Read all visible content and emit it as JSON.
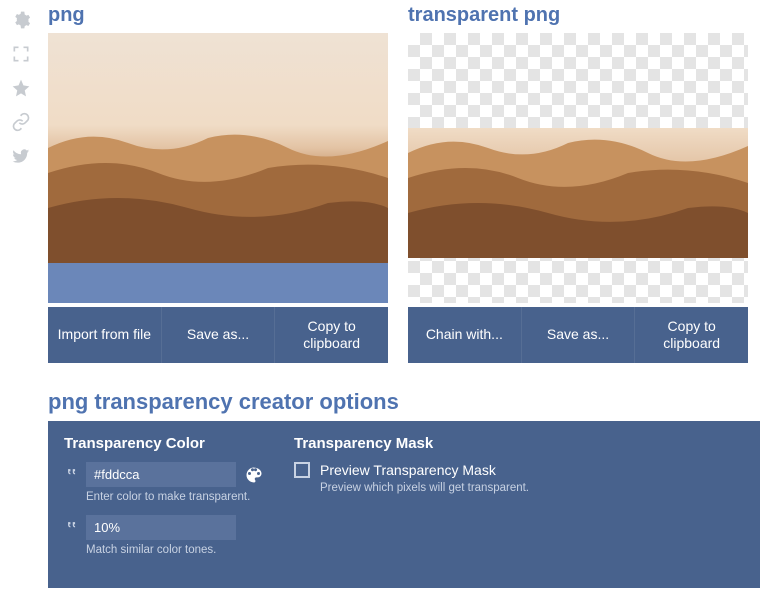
{
  "sidebar": {
    "icons": [
      "gear",
      "fullscreen",
      "star",
      "link",
      "twitter"
    ]
  },
  "panels": {
    "left": {
      "title": "png",
      "buttons": [
        "Import from file",
        "Save as...",
        "Copy to clipboard"
      ]
    },
    "right": {
      "title": "transparent png",
      "buttons": [
        "Chain with...",
        "Save as...",
        "Copy to clipboard"
      ]
    }
  },
  "options": {
    "title": "png transparency creator options",
    "color": {
      "heading": "Transparency Color",
      "value": "#fddcca",
      "hint": "Enter color to make transparent.",
      "tolerance_value": "10%",
      "tolerance_hint": "Match similar color tones."
    },
    "mask": {
      "heading": "Transparency Mask",
      "label": "Preview Transparency Mask",
      "hint": "Preview which pixels will get transparent."
    }
  }
}
